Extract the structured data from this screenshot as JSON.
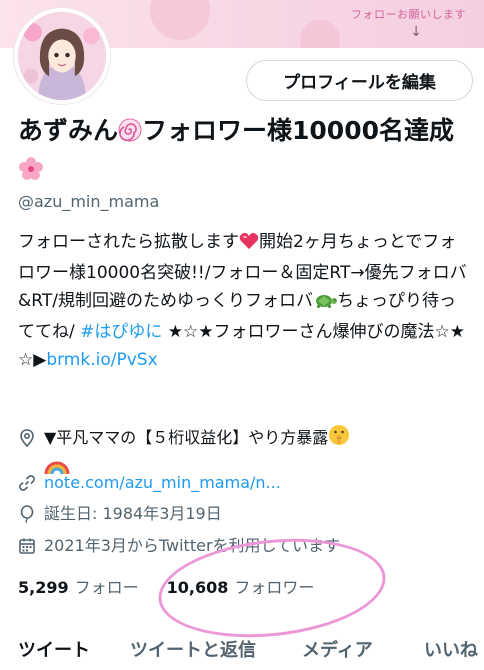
{
  "banner": {
    "text": "フォローお願いします",
    "arrow": "↓"
  },
  "header": {
    "edit_profile_label": "プロフィールを編集"
  },
  "profile": {
    "name_prefix": "あずみん",
    "name_main": "フォロワー様10000名達成",
    "handle": "@azu_min_mama",
    "bio_part1": "フォローされたら拡散します",
    "bio_part2": "開始2ヶ月ちょっとでフォロワー様10000名突破!!/フォロー＆固定RT→優先フォロバ&RT/規制回避のためゆっくりフォロバ",
    "bio_part3": "ちょっぴり待っててね/ ",
    "bio_hashtag": "#はぴゆに",
    "bio_part4": " ★☆★フォロワーさん爆伸びの魔法☆★☆▶",
    "bio_link": "brmk.io/PvSx"
  },
  "meta": {
    "location": "▼平凡ママの【５桁収益化】やり方暴露",
    "website": "note.com/azu_min_mama/n...",
    "birthday": "誕生日: 1984年3月19日",
    "joined": "2021年3月からTwitterを利用しています"
  },
  "counts": {
    "following_count": "5,299",
    "following_label": "フォロー",
    "followers_count": "10,608",
    "followers_label": "フォロワー"
  },
  "tabs": [
    {
      "label": "ツイート"
    },
    {
      "label": "ツイートと返信"
    },
    {
      "label": "メディア"
    },
    {
      "label": "いいね"
    }
  ],
  "icons": [
    "swirl-emoji-icon",
    "cherry-blossom-icon",
    "heart-icon",
    "turtle-icon",
    "location-icon",
    "shush-face-icon",
    "rainbow-icon",
    "link-icon",
    "balloon-icon",
    "calendar-icon"
  ],
  "colors": {
    "accent": "#1d9bf0",
    "text": "#0f1419",
    "secondary": "#536471",
    "highlight_circle": "#ec97d6"
  }
}
